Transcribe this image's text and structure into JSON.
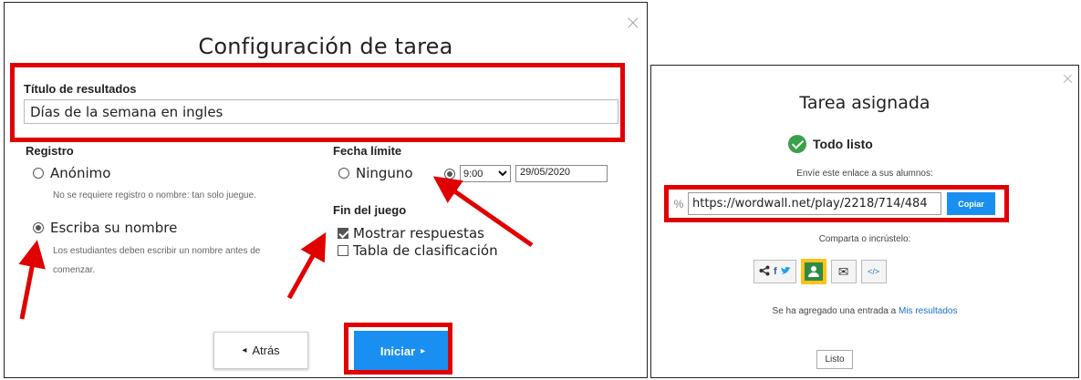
{
  "left_dialog": {
    "title": "Configuración de tarea",
    "close_symbol": "×",
    "results_title_label": "Título de resultados",
    "results_title_value": "Días de la semana en ingles",
    "registro": {
      "label": "Registro",
      "option_anonymous": "Anónimo",
      "option_anonymous_hint": "No se requiere registro o nombre: tan solo juegue.",
      "option_name": "Escriba su nombre",
      "option_name_hint_line1": "Los estudiantes deben escribir un nombre antes de",
      "option_name_hint_line2": "comenzar.",
      "selected": "option_name"
    },
    "fecha_limite": {
      "label": "Fecha límite",
      "option_none": "Ninguno",
      "time_value": "9:00",
      "date_value": "29/05/2020",
      "selected": "date"
    },
    "fin_del_juego": {
      "label": "Fin del juego",
      "show_answers": "Mostrar respuestas",
      "show_answers_checked": true,
      "leaderboard": "Tabla de clasificación",
      "leaderboard_checked": false
    },
    "back_button": "Atrás",
    "back_icon": "◂",
    "start_button": "Iniciar",
    "start_icon": "▸"
  },
  "right_dialog": {
    "title": "Tarea asignada",
    "close_symbol": "×",
    "status": "Todo listo",
    "send_text": "Envíe este enlace a sus alumnos:",
    "link_icon": "%",
    "link_value": "https://wordwall.net/play/2218/714/484",
    "copy_button": "Copiar",
    "share_text": "Comparta o incrústelo:",
    "share_icons": [
      "share-icon",
      "facebook-icon",
      "twitter-icon",
      "google-classroom-icon",
      "email-icon",
      "embed-icon"
    ],
    "share_glyph": "<",
    "facebook_glyph": "f",
    "twitter_glyph": "🐦",
    "email_glyph": "✉",
    "embed_glyph": "</>",
    "results_prefix": "Se ha agregado una entrada a ",
    "results_link": "Mis resultados",
    "done_button": "Listo"
  },
  "colors": {
    "highlight_red": "#e00000",
    "primary_blue": "#1a8ff2",
    "success_green": "#3aa14a",
    "classroom_yellow": "#ffc21a",
    "classroom_green": "#2e8a45"
  }
}
